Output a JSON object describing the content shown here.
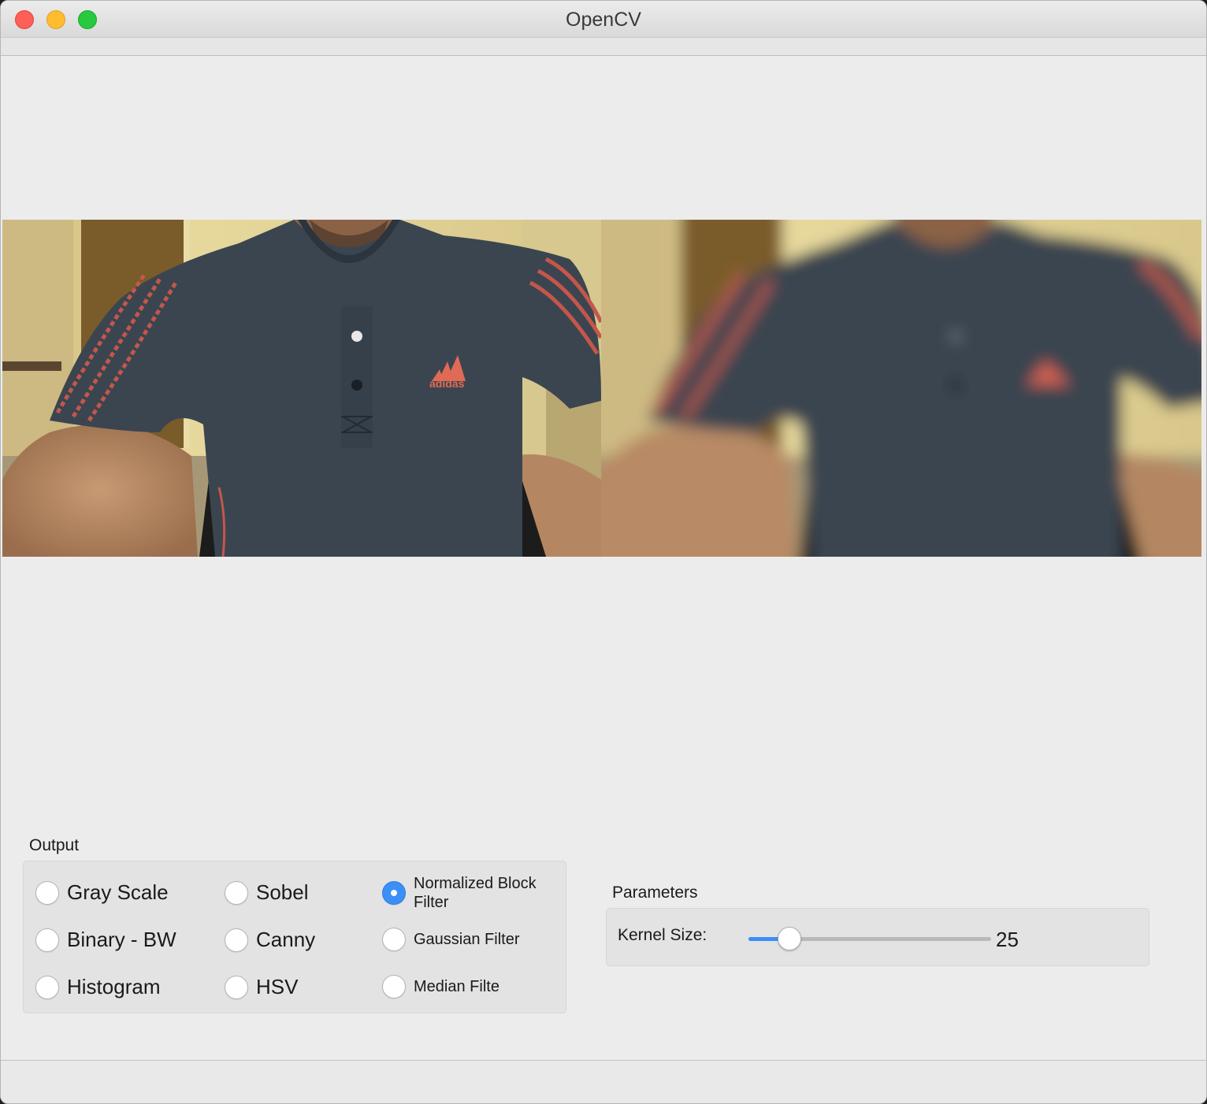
{
  "window": {
    "title": "OpenCV"
  },
  "output": {
    "title": "Output",
    "options": [
      {
        "label": "Gray Scale",
        "checked": false
      },
      {
        "label": "Sobel",
        "checked": false
      },
      {
        "label": "Normalized Block Filter",
        "checked": true
      },
      {
        "label": "Binary - BW",
        "checked": false
      },
      {
        "label": "Canny",
        "checked": false
      },
      {
        "label": "Gaussian Filter",
        "checked": false
      },
      {
        "label": "Histogram",
        "checked": false
      },
      {
        "label": "HSV",
        "checked": false
      },
      {
        "label": "Median Filte",
        "checked": false
      }
    ]
  },
  "parameters": {
    "title": "Parameters",
    "kernel_label": "Kernel Size:",
    "kernel_value": "25",
    "slider_fraction": 0.17
  },
  "colors": {
    "accent": "#3b8ff7",
    "close": "#fe5f57",
    "minimize": "#febc2e",
    "maximize": "#28c840"
  },
  "images": {
    "left": "webcam-original-frame",
    "right": "webcam-blurred-frame",
    "logo_text": "adidas"
  }
}
